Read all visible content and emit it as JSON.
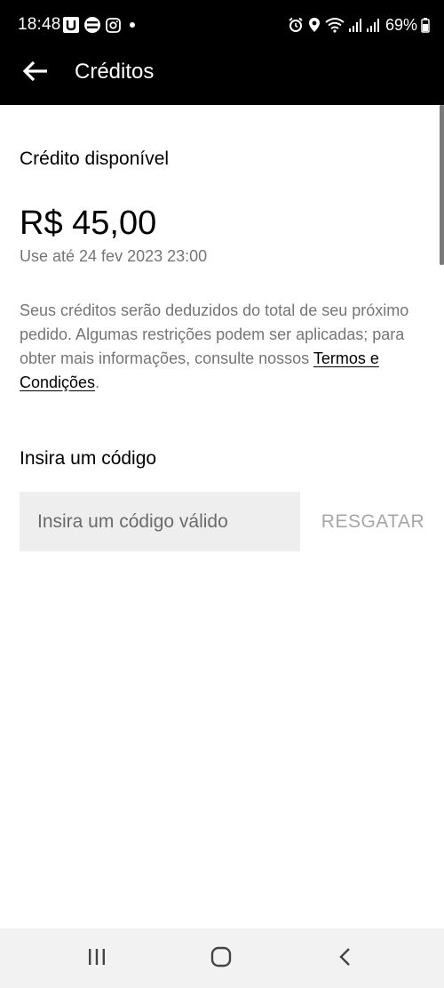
{
  "status_bar": {
    "time": "18:48",
    "battery": "69%",
    "left_icons": [
      "uber-icon",
      "uber-eats-icon",
      "instagram-icon",
      "notification-dot-icon"
    ],
    "right_icons": [
      "alarm-icon",
      "location-icon",
      "wifi-icon",
      "signal-icon",
      "signal-icon",
      "battery-icon"
    ]
  },
  "app_bar": {
    "title": "Créditos",
    "back_icon": "arrow-left-icon"
  },
  "credit": {
    "heading": "Crédito disponível",
    "amount": "R$ 45,00",
    "expiry": "Use até 24 fev 2023 23:00",
    "description": "Seus créditos serão deduzidos do total de seu próximo pedido. Algumas restrições podem ser aplicadas; para obter mais informações, consulte nossos ",
    "terms_link": "Termos e Condições",
    "description_end": "."
  },
  "code": {
    "heading": "Insira um código",
    "placeholder": "Insira um código válido",
    "value": "",
    "redeem_label": "RESGATAR"
  },
  "nav_bar": {
    "icons": [
      "recents-icon",
      "home-icon",
      "back-icon"
    ]
  },
  "colors": {
    "header_bg": "#000000",
    "muted_text": "#757575",
    "input_bg": "#eeeeee",
    "disabled_button": "#a6a6a6",
    "nav_bg": "#f2f2f2"
  }
}
